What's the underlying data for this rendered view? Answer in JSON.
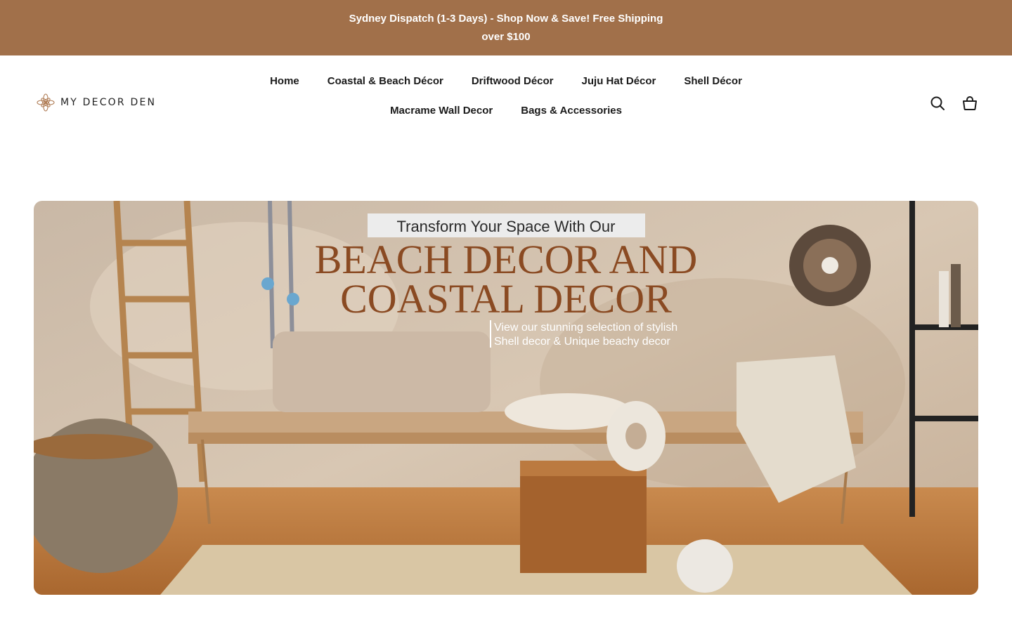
{
  "announcement": {
    "text": "Sydney Dispatch (1-3 Days) - Shop Now & Save! Free Shipping over $100"
  },
  "header": {
    "logo_text": "MY DECOR DEN",
    "nav": [
      {
        "label": "Home"
      },
      {
        "label": "Coastal & Beach Décor"
      },
      {
        "label": "Driftwood Décor"
      },
      {
        "label": "Juju Hat Décor"
      },
      {
        "label": "Shell Décor"
      },
      {
        "label": "Macrame Wall Decor"
      },
      {
        "label": "Bags & Accessories"
      }
    ],
    "icons": [
      "search-icon",
      "cart-icon"
    ]
  },
  "hero": {
    "tagline": "Transform Your Space With Our",
    "title_line1": "BEACH DECOR AND",
    "title_line2": "COASTAL DECOR",
    "sub_line1": "View our stunning selection of stylish",
    "sub_line2": "Shell decor & Unique beachy decor"
  },
  "colors": {
    "announcement_bg": "#a1704a",
    "hero_title": "#8a4a22"
  }
}
